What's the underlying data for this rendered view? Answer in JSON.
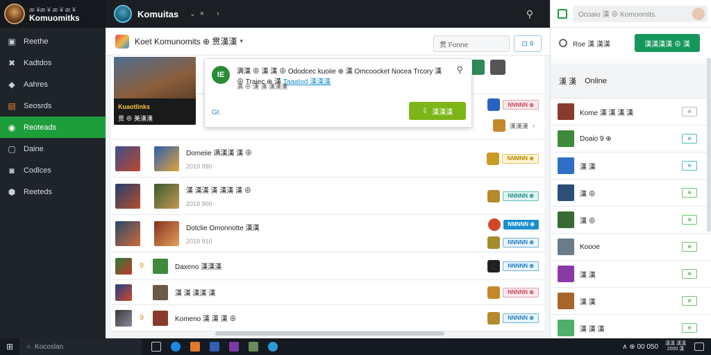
{
  "app": {
    "brand_line1": "æ ¥æ ¥ æ ¥ æ ¥",
    "brand_name": "Komuomitks"
  },
  "sidebar": {
    "items": [
      {
        "label": "Reethe",
        "icon": "store-icon"
      },
      {
        "label": "Kadtdos",
        "icon": "tools-icon"
      },
      {
        "label": "Aahres",
        "icon": "bell-icon"
      },
      {
        "label": "Seosrds",
        "icon": "grid-icon"
      },
      {
        "label": "Reoteads",
        "icon": "chart-icon"
      },
      {
        "label": "Daine",
        "icon": "chat-icon"
      },
      {
        "label": "Codlces",
        "icon": "box-icon"
      },
      {
        "label": "Reeteds",
        "icon": "cloud-icon"
      }
    ],
    "active_index": 4
  },
  "topbar": {
    "title": "Komuitas",
    "chevron": "⌄",
    "close": "×",
    "arrow": "›",
    "search_icon": "⚲"
  },
  "main": {
    "header_title": "Koet Komunomits ⊕ 贯漢漢",
    "search_placeholder": "贯 Fonne",
    "search_btn": "⊡ 9"
  },
  "hero": {
    "caption_title": "Kuaotlinks",
    "caption_sub": "贯 ⊕ 美漢漢"
  },
  "popup": {
    "icon_text": "IE",
    "line1_a": "满漢 ⊕ 漢 漢 ⊕ Ododcec kuoiie ⊕ 漢 Omcoocket Nocea",
    "line1_b": "Trcory 漢 ⊕ Traiec ⊕ 漢 ",
    "link": "Taaatod 漢漢漢",
    "line2": "满 ⊕ 漢 漢 漢漢漢",
    "gt": "Gt",
    "download": "漢漢漢"
  },
  "rows": [
    {
      "title": "Domeiie 满漢漢 漢 ⊕",
      "date": "2019 990",
      "num": "",
      "badges": [
        {
          "text": "NNMNN ⊕",
          "style": "yellow"
        }
      ]
    },
    {
      "title": "漢 漢漢 漢 漢漢 漢 ⊕",
      "date": "2019 900",
      "num": "",
      "badges": [
        {
          "text": "NNNNN ⊕",
          "style": "teal"
        }
      ]
    },
    {
      "title": "Dotclie Omonnotte 漢漢",
      "date": "2019 910",
      "num": "",
      "badges": [
        {
          "text": "NMNNN ⊕",
          "style": "blue"
        },
        {
          "text": "NNNNN ⊕",
          "style": "blue-o"
        }
      ]
    },
    {
      "title": "Daxeno 漢漢漢",
      "date": "",
      "num": "9",
      "badges": [
        {
          "text": "NNNNN ⊕",
          "style": "blue-o"
        }
      ]
    },
    {
      "title": "漢 漢 漢漢 漢",
      "date": "",
      "num": "",
      "badges": [
        {
          "text": "NNNNN ⊕",
          "style": "pink"
        }
      ]
    },
    {
      "title": "Komeno 漢 漢 漢 ⊕",
      "date": "",
      "num": "9",
      "badges": [
        {
          "text": "NNNNN ⊕",
          "style": "blue-o"
        }
      ]
    }
  ],
  "top_rows_badges": [
    {
      "text": "NNNNN ⊕",
      "style": "pink"
    },
    {
      "text": "漢漢漢",
      "style": "plain"
    }
  ],
  "right": {
    "search_placeholder": "Ocoaio 漢 ⊕ Komoomits.",
    "filter_label": "Roe 漢 漢漢",
    "filter_btn": "漢漢漢漢 ⊕ 漢",
    "online_a": "漢 漢",
    "online_b": "Online",
    "items": [
      {
        "label": "Kome 漢 漢 漢 漢",
        "sw": "⊕",
        "style": "plain",
        "color": "#8a3a2c"
      },
      {
        "label": "Doaio 9 ⊕",
        "sw": "⊕",
        "style": "teal",
        "color": "#3d8a3a"
      },
      {
        "label": "漢 漢",
        "sw": "⊕",
        "style": "teal",
        "color": "#2f6fc7"
      },
      {
        "label": "漢 ⊕",
        "sw": "⊕",
        "style": "green",
        "color": "#2b4f78"
      },
      {
        "label": "漢 ⊕",
        "sw": "⊕",
        "style": "green",
        "color": "#3a6a34"
      },
      {
        "label": "Koooe",
        "sw": "⊕",
        "style": "green",
        "color": "#6a7b8a"
      },
      {
        "label": "漢 漢",
        "sw": "⊕",
        "style": "green",
        "color": "#8a3aa6"
      },
      {
        "label": "漢 漢",
        "sw": "⊕",
        "style": "green",
        "color": "#a8652a"
      },
      {
        "label": "漢 漢 漢",
        "sw": "⊕",
        "style": "green",
        "color": "#4fb06a"
      }
    ]
  },
  "taskbar": {
    "search": "Kocoslan",
    "tray": "∧ ⊕ 00 050",
    "clock1": "漢漢 漢漢",
    "clock2": "2000 漢"
  }
}
